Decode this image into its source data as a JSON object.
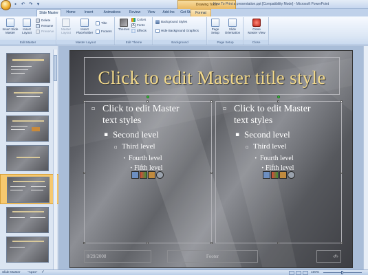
{
  "window": {
    "title": "How To Print a presentation.ppt [Compatibility Mode] - Microsoft PowerPoint",
    "contextual_tab": "Drawing Tools"
  },
  "tabs": [
    "Slide Master",
    "Home",
    "Insert",
    "Animations",
    "Review",
    "View",
    "Add-Ins",
    "Get Started",
    "Format"
  ],
  "ribbon": {
    "edit_master": {
      "label": "Edit Master",
      "insert_slide_master": [
        "Insert Slide",
        "Master"
      ],
      "insert_layout": [
        "Insert",
        "Layout"
      ],
      "delete": "Delete",
      "rename": "Rename",
      "preserve": "Preserve"
    },
    "master_layout": {
      "label": "Master Layout",
      "master_layout_btn": [
        "Master",
        "Layout"
      ],
      "insert_placeholder": [
        "Insert",
        "Placeholder"
      ],
      "title": "Title",
      "footers": "Footers"
    },
    "edit_theme": {
      "label": "Edit Theme",
      "themes": "Themes",
      "colors": "Colors",
      "fonts": "Fonts",
      "effects": "Effects"
    },
    "background": {
      "label": "Background",
      "background_styles": "Background Styles",
      "hide_background_graphics": "Hide Background Graphics"
    },
    "page_setup": {
      "label": "Page Setup",
      "page_setup_btn": [
        "Page",
        "Setup"
      ],
      "slide_orientation": [
        "Slide",
        "Orientation"
      ]
    },
    "close": {
      "label": "Close",
      "close_master_view": [
        "Close",
        "Master View"
      ]
    }
  },
  "slide": {
    "title": "Click to edit Master title style",
    "left": {
      "level1": [
        "Click to edit Master",
        "text styles"
      ],
      "level2": "Second level",
      "level3": "Third level",
      "level4": "Fourth level",
      "level5": "Fifth level"
    },
    "right": {
      "level1": [
        "Click to edit Master",
        "text styles"
      ],
      "level2": "Second level",
      "level3": "Third level",
      "level4": "Fourth level",
      "level5": "Fifth level"
    },
    "footer_date": "8/29/2008",
    "footer_text": "Footer",
    "footer_number": "‹#›"
  },
  "status": {
    "view": "Slide Master",
    "theme": "\"Apex\"",
    "zoom": "100%"
  },
  "colors": {
    "title_gold": "#f2d98b",
    "body_text": "#ffffff",
    "selected_thumb": "#f6c86e"
  }
}
